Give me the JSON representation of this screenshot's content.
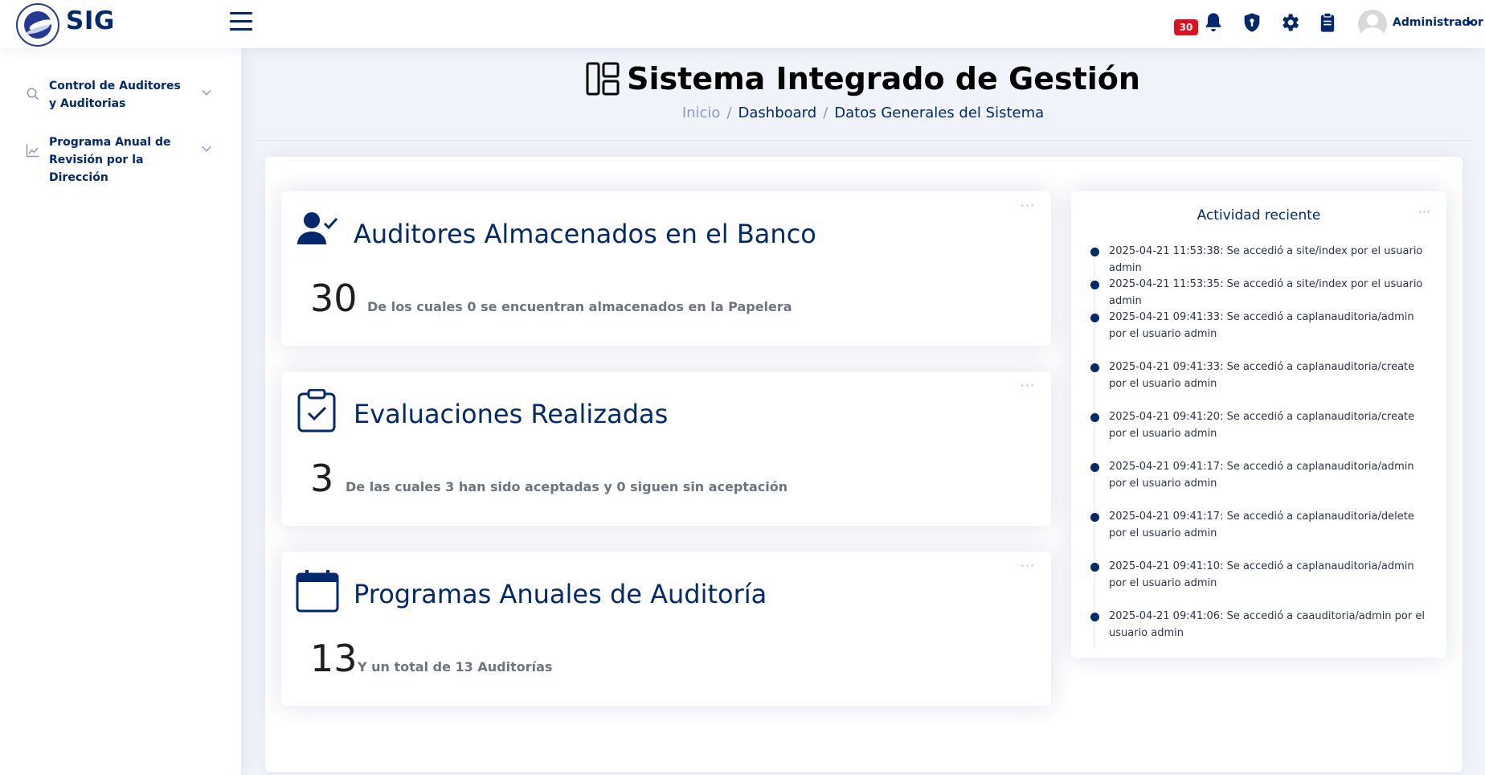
{
  "header": {
    "brand": "SIG",
    "notification_count": "30",
    "user_name": "Administrador"
  },
  "sidebar": {
    "items": [
      {
        "label": "Control de Auditores y Auditorias",
        "icon": "search-icon"
      },
      {
        "label": "Programa Anual de Revisión por la Dirección",
        "icon": "chart-icon"
      }
    ]
  },
  "page": {
    "title": "Sistema Integrado de Gestión",
    "breadcrumb": [
      "Inicio",
      "Dashboard",
      "Datos Generales del Sistema"
    ]
  },
  "cards": [
    {
      "title": "Auditores Almacenados en el Banco",
      "value": "30",
      "description": "De los cuales 0 se encuentran almacenados en la Papelera",
      "icon": "user-check-icon"
    },
    {
      "title": "Evaluaciones Realizadas",
      "value": "3",
      "description": "De las cuales 3 han sido aceptadas y 0 siguen sin aceptación",
      "icon": "clipboard-check-icon"
    },
    {
      "title": "Programas Anuales de Auditoría",
      "value": "13",
      "description": "Y un total de 13 Auditorías",
      "icon": "calendar-icon"
    }
  ],
  "activity": {
    "title": "Actividad reciente",
    "items": [
      "2025-04-21 11:53:38: Se accedió a site/index por el usuario admin",
      "2025-04-21 11:53:35: Se accedió a site/index por el usuario admin",
      "2025-04-21 09:41:33: Se accedió a caplanauditoria/admin por el usuario admin",
      "2025-04-21 09:41:33: Se accedió a caplanauditoria/create por el usuario admin",
      "2025-04-21 09:41:20: Se accedió a caplanauditoria/create por el usuario admin",
      "2025-04-21 09:41:17: Se accedió a caplanauditoria/admin por el usuario admin",
      "2025-04-21 09:41:17: Se accedió a caplanauditoria/delete por el usuario admin",
      "2025-04-21 09:41:10: Se accedió a caplanauditoria/admin por el usuario admin",
      "2025-04-21 09:41:06: Se accedió a caauditoria/admin por el usuario admin"
    ]
  },
  "colors": {
    "primary": "#012970",
    "badge": "#e0101f",
    "background": "#f0f3f9"
  }
}
